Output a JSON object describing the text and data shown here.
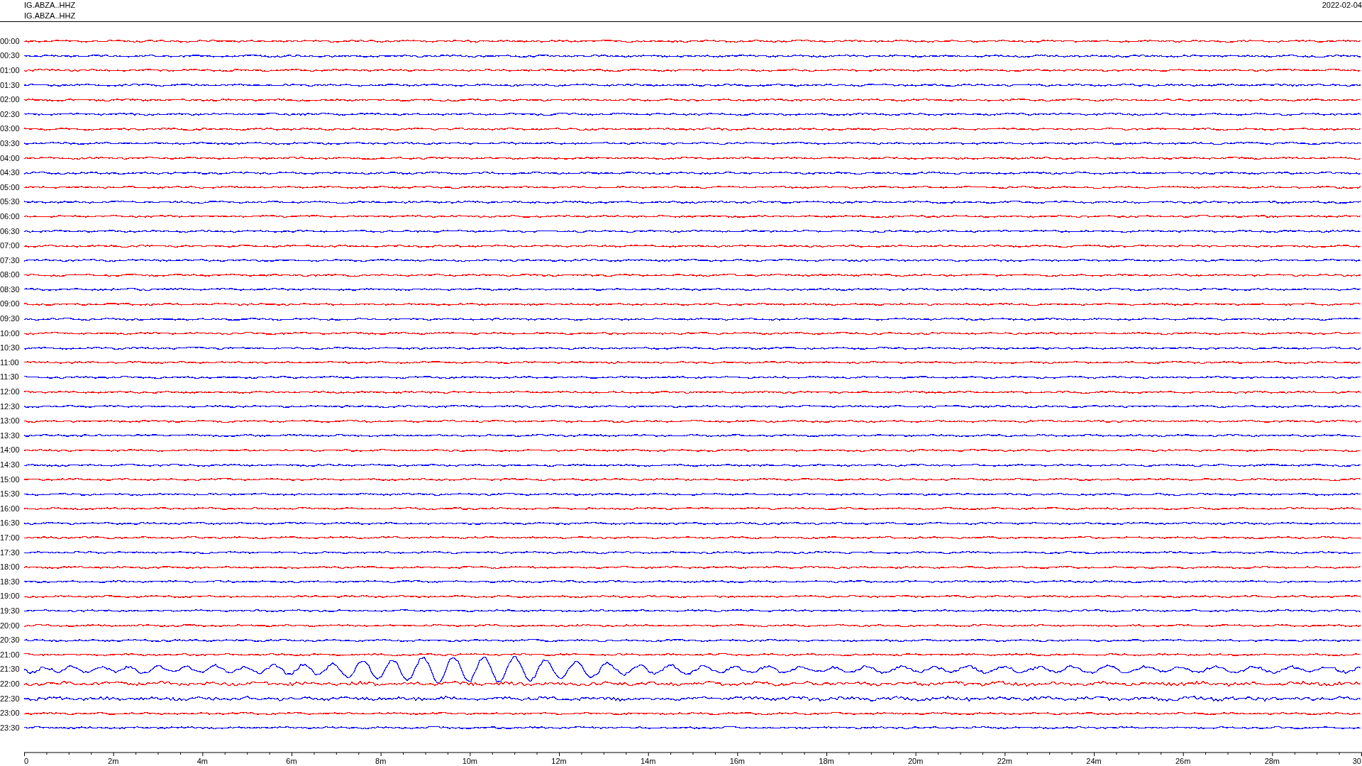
{
  "header": {
    "lines": [
      "IG.ABZA..HHZ",
      "IG.ABZA..HHZ"
    ],
    "date": "2022-02-04"
  },
  "traces": [
    {
      "label": "00:00",
      "color": "#ff0000",
      "kind": "normal"
    },
    {
      "label": "00:30",
      "color": "#0000ff",
      "kind": "normal"
    },
    {
      "label": "01:00",
      "color": "#ff0000",
      "kind": "normal"
    },
    {
      "label": "01:30",
      "color": "#0000ff",
      "kind": "normal"
    },
    {
      "label": "02:00",
      "color": "#ff0000",
      "kind": "normal"
    },
    {
      "label": "02:30",
      "color": "#0000ff",
      "kind": "normal"
    },
    {
      "label": "03:00",
      "color": "#ff0000",
      "kind": "normal"
    },
    {
      "label": "03:30",
      "color": "#0000ff",
      "kind": "normal"
    },
    {
      "label": "04:00",
      "color": "#ff0000",
      "kind": "normal"
    },
    {
      "label": "04:30",
      "color": "#0000ff",
      "kind": "normal"
    },
    {
      "label": "05:00",
      "color": "#ff0000",
      "kind": "normal"
    },
    {
      "label": "05:30",
      "color": "#0000ff",
      "kind": "normal"
    },
    {
      "label": "06:00",
      "color": "#ff0000",
      "kind": "normal"
    },
    {
      "label": "06:30",
      "color": "#0000ff",
      "kind": "normal"
    },
    {
      "label": "07:00",
      "color": "#ff0000",
      "kind": "normal"
    },
    {
      "label": "07:30",
      "color": "#0000ff",
      "kind": "normal"
    },
    {
      "label": "08:00",
      "color": "#ff0000",
      "kind": "normal"
    },
    {
      "label": "08:30",
      "color": "#0000ff",
      "kind": "normal"
    },
    {
      "label": "09:00",
      "color": "#ff0000",
      "kind": "normal"
    },
    {
      "label": "09:30",
      "color": "#0000ff",
      "kind": "normal"
    },
    {
      "label": "10:00",
      "color": "#ff0000",
      "kind": "normal"
    },
    {
      "label": "10:30",
      "color": "#0000ff",
      "kind": "normal"
    },
    {
      "label": "11:00",
      "color": "#ff0000",
      "kind": "normal"
    },
    {
      "label": "11:30",
      "color": "#0000ff",
      "kind": "normal"
    },
    {
      "label": "12:00",
      "color": "#ff0000",
      "kind": "normal"
    },
    {
      "label": "12:30",
      "color": "#0000ff",
      "kind": "normal"
    },
    {
      "label": "13:00",
      "color": "#ff0000",
      "kind": "normal"
    },
    {
      "label": "13:30",
      "color": "#0000ff",
      "kind": "normal"
    },
    {
      "label": "14:00",
      "color": "#ff0000",
      "kind": "normal"
    },
    {
      "label": "14:30",
      "color": "#0000ff",
      "kind": "normal"
    },
    {
      "label": "15:00",
      "color": "#ff0000",
      "kind": "normal"
    },
    {
      "label": "15:30",
      "color": "#0000ff",
      "kind": "normal"
    },
    {
      "label": "16:00",
      "color": "#ff0000",
      "kind": "normal"
    },
    {
      "label": "16:30",
      "color": "#0000ff",
      "kind": "normal"
    },
    {
      "label": "17:00",
      "color": "#ff0000",
      "kind": "normal"
    },
    {
      "label": "17:30",
      "color": "#0000ff",
      "kind": "normal"
    },
    {
      "label": "18:00",
      "color": "#ff0000",
      "kind": "normal"
    },
    {
      "label": "18:30",
      "color": "#0000ff",
      "kind": "normal"
    },
    {
      "label": "19:00",
      "color": "#ff0000",
      "kind": "normal"
    },
    {
      "label": "19:30",
      "color": "#0000ff",
      "kind": "normal"
    },
    {
      "label": "20:00",
      "color": "#ff0000",
      "kind": "normal"
    },
    {
      "label": "20:30",
      "color": "#0000ff",
      "kind": "normal"
    },
    {
      "label": "21:00",
      "color": "#ff0000",
      "kind": "normal"
    },
    {
      "label": "21:30",
      "color": "#0000ff",
      "kind": "surface_waves"
    },
    {
      "label": "22:00",
      "color": "#ff0000",
      "kind": "coda"
    },
    {
      "label": "22:30",
      "color": "#0000ff",
      "kind": "coda"
    },
    {
      "label": "23:00",
      "color": "#ff0000",
      "kind": "normal"
    },
    {
      "label": "23:30",
      "color": "#0000ff",
      "kind": "normal"
    }
  ],
  "x_axis": {
    "ticks": [
      "0",
      "2m",
      "4m",
      "6m",
      "8m",
      "10m",
      "12m",
      "14m",
      "16m",
      "18m",
      "20m",
      "22m",
      "24m",
      "26m",
      "28m",
      "30"
    ]
  }
}
